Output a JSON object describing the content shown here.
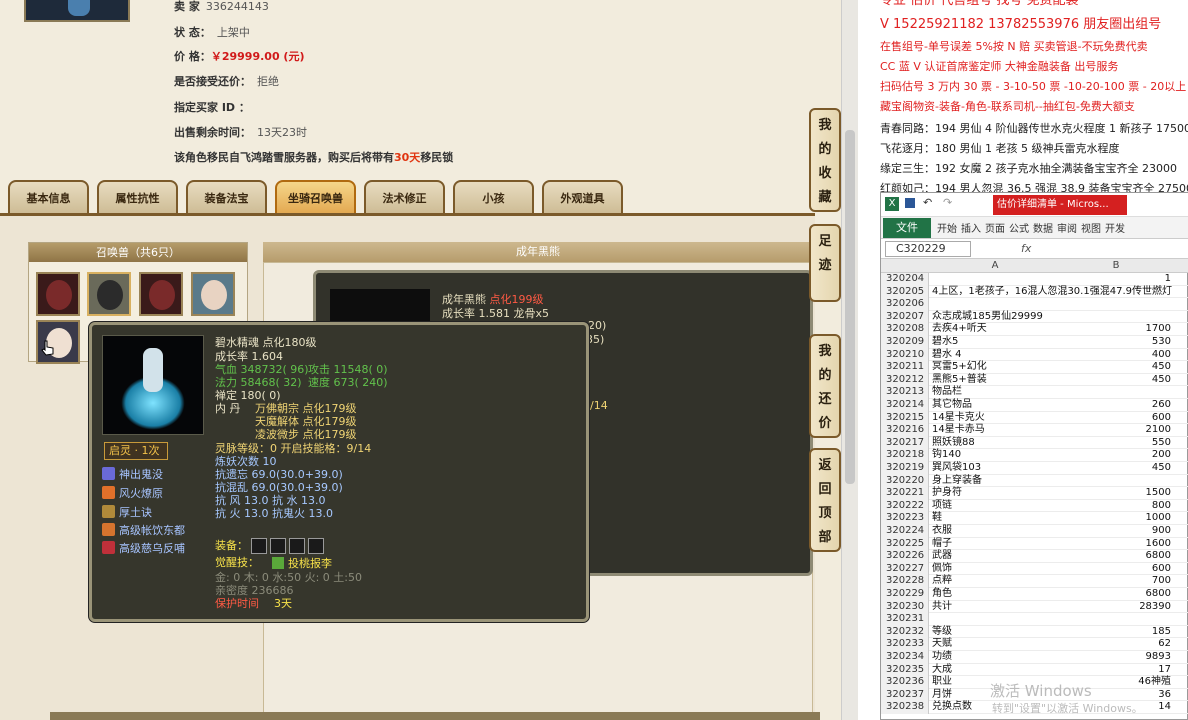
{
  "seller": {
    "seller_label": "卖   家",
    "seller_value": "336244143",
    "status_label": "状       态：",
    "status_value": "上架中",
    "price_label": "价       格：",
    "price_value": "￥29999.00 (元)",
    "bargain_label": "是否接受还价：",
    "bargain_value": "拒绝",
    "buyer_label": "指定买家 ID ：",
    "remaining_label": "出售剩余时间：",
    "remaining_value": "13天23时",
    "migrate_notice_pre": "该角色移民自飞鸿踏雪服务器，购买后将带有",
    "migrate_notice_days": "30天",
    "migrate_notice_post": "移民锁"
  },
  "tabs": [
    {
      "label": "基本信息"
    },
    {
      "label": "属性抗性"
    },
    {
      "label": "装备法宝"
    },
    {
      "label": "坐骑召唤兽",
      "active": true
    },
    {
      "label": "法术修正"
    },
    {
      "label": "小孩"
    },
    {
      "label": "外观道具"
    }
  ],
  "pet_list": {
    "title": "召唤兽（共6只）",
    "pets": [
      {
        "icon": "red-mask-pet-icon",
        "color": "#7a2a2a"
      },
      {
        "icon": "black-bear-pet-icon",
        "color": "#2b2b2b"
      },
      {
        "icon": "red-mask-pet-icon",
        "color": "#7a2a2a"
      },
      {
        "icon": "lady-pet-icon",
        "color": "#e8d3c2"
      },
      {
        "icon": "pale-face-pet-icon",
        "color": "#efe0d2"
      }
    ]
  },
  "adult_panel": {
    "title": "成年黑熊"
  },
  "bear_popup": {
    "name": "成年黑熊",
    "evolve": "点化199级",
    "growth_line": "成长率 1.581 龙骨x5",
    "partial1": "20)",
    "partial2": "35)",
    "partial3": "/14"
  },
  "pet_detail": {
    "name": "碧水精魂",
    "evolve": "点化180级",
    "growth": "成长率 1.604",
    "hp": "气血 348732( 96)",
    "attack": "攻击 11548( 0)",
    "mana": "法力 58468( 32)",
    "speed": "速度 673( 240)",
    "zen": "禅定 180( 0)",
    "neidan_label": "内   丹",
    "neidan1": "万佛朝宗 点化179级",
    "neidan2": "天魔解体 点化179级",
    "neidan3": "凌波微步 点化179级",
    "spirit_level": "灵脉等级：0 开启技能格：9/14",
    "demon_count": "炼妖次数 10",
    "anti_shock": "抗遗忘 69.0(30.0+39.0)",
    "anti_chaos": "抗混乱 69.0(30.0+39.0)",
    "anti_wind_water": "抗   风 13.0  抗   水 13.0",
    "anti_fire_ghost": "抗   火 13.0  抗鬼火 13.0",
    "awaken": "启灵 · 1次",
    "skills": [
      {
        "name": "神出鬼没",
        "icon": "ghost-skill-icon",
        "color": "#6a6ad8"
      },
      {
        "name": "风火燎原",
        "icon": "fire-skill-icon",
        "color": "#e0702a"
      },
      {
        "name": "厚土诀",
        "icon": "earth-skill-icon",
        "color": "#b08a3a"
      },
      {
        "name": "高级帐饮东都",
        "icon": "feast-skill-icon",
        "color": "#d6742e"
      },
      {
        "name": "高级慈乌反哺",
        "icon": "crow-skill-icon",
        "color": "#c0303a"
      }
    ],
    "equip_label": "装备：",
    "awaken_skill_label": "觉醒技：",
    "awaken_skill": "投桃报李",
    "elements": "金: 0 木: 0 水:50 火: 0 土:50",
    "intimacy": "亲密度 236686",
    "protect_label": "保护时间",
    "protect_value": "3天"
  },
  "side_buttons": [
    {
      "label": "我的收藏"
    },
    {
      "label": "足迹"
    },
    {
      "label": "我的还价"
    },
    {
      "label": "返回顶部"
    }
  ],
  "ad_text": {
    "line0": "专业 估价 代售组号 找号 免费配装",
    "line1": "V 15225921182   13782553976 朋友圈出组号",
    "line2": "在售组号-单号误差 5%按 N 赔 买卖管退-不玩免费代卖",
    "line3": "CC 蓝 V 认证首席鉴定师 大神金融装备 出号服务",
    "line4": "扫码估号 3 万内 30 票 - 3-10-50 票  -10-20-100 票 - 20以上 150",
    "line5": "藏宝阁物资-装备-角色-联系司机--抽红包-免费大额支",
    "line6": "青春同路：194 男仙 4 阶仙器传世水克火程度 1 新孩子 17500",
    "line7": "飞花逐月：180 男仙 1 老孩 5 级神兵雷克水程度",
    "line8": "缘定三生：192 女魔 2 孩子克水抽全满装备宝宝齐全 23000",
    "line9": "红颜如己：194 男人忽混 36.5 强混 38.9 装备宝宝齐全 27500"
  },
  "excel": {
    "title_badge": "估价详细清单 - Micros...",
    "ribbon_file": "文件",
    "ribbon_tabs": [
      "开始",
      "插入",
      "页面",
      "公式",
      "数据",
      "审阅",
      "视图",
      "开发"
    ],
    "name_box": "C320229",
    "fx": "fx",
    "col_a": "A",
    "col_b": "B",
    "rows": [
      {
        "n": "320204",
        "a": "",
        "b": "1"
      },
      {
        "n": "320205",
        "a": "4上区，1老孩子，16混人忽混30.1强混47.9传世燃灯",
        "b": ""
      },
      {
        "n": "320206",
        "a": "",
        "b": ""
      },
      {
        "n": "320207",
        "a": "众志成城185男仙29999",
        "b": ""
      },
      {
        "n": "320208",
        "a": "去疾4+听天",
        "b": "1700"
      },
      {
        "n": "320209",
        "a": "碧水5",
        "b": "530"
      },
      {
        "n": "320210",
        "a": "碧水 4",
        "b": "400"
      },
      {
        "n": "320211",
        "a": "冥雷5+幻化",
        "b": "450"
      },
      {
        "n": "320212",
        "a": "黑熊5+普装",
        "b": "450"
      },
      {
        "n": "320213",
        "a": "物品栏",
        "b": ""
      },
      {
        "n": "320214",
        "a": "其它物品",
        "b": "260"
      },
      {
        "n": "320215",
        "a": "14星卡克火",
        "b": "600"
      },
      {
        "n": "320216",
        "a": "14星卡赤马",
        "b": "2100"
      },
      {
        "n": "320217",
        "a": "照妖镜88",
        "b": "550"
      },
      {
        "n": "320218",
        "a": "钩140",
        "b": "200"
      },
      {
        "n": "320219",
        "a": "巽风袋103",
        "b": "450"
      },
      {
        "n": "320220",
        "a": "身上穿装备",
        "b": ""
      },
      {
        "n": "320221",
        "a": "护身符",
        "b": "1500"
      },
      {
        "n": "320222",
        "a": "项链",
        "b": "800"
      },
      {
        "n": "320223",
        "a": "鞋",
        "b": "1000"
      },
      {
        "n": "320224",
        "a": "衣服",
        "b": "900"
      },
      {
        "n": "320225",
        "a": "帽子",
        "b": "1600"
      },
      {
        "n": "320226",
        "a": "武器",
        "b": "6800"
      },
      {
        "n": "320227",
        "a": "佩饰",
        "b": "600"
      },
      {
        "n": "320228",
        "a": "点粹",
        "b": "700"
      },
      {
        "n": "320229",
        "a": "角色",
        "b": "6800"
      },
      {
        "n": "320230",
        "a": "共计",
        "b": "28390"
      },
      {
        "n": "320231",
        "a": "",
        "b": ""
      },
      {
        "n": "320232",
        "a": "等级",
        "b": "185"
      },
      {
        "n": "320233",
        "a": "天赋",
        "b": "62"
      },
      {
        "n": "320234",
        "a": "功绩",
        "b": "9893"
      },
      {
        "n": "320235",
        "a": "大成",
        "b": "17"
      },
      {
        "n": "320236",
        "a": "职业",
        "b": "46神殖"
      },
      {
        "n": "320237",
        "a": "月饼",
        "b": "36"
      },
      {
        "n": "320238",
        "a": "兑换点数",
        "b": "14"
      }
    ]
  },
  "watermark": {
    "line1": "激活 Windows",
    "line2": "转到\"设置\"以激活 Windows。"
  }
}
